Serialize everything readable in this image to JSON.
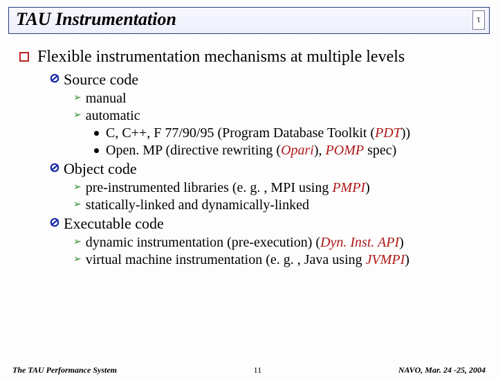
{
  "title": "TAU Instrumentation",
  "logo_glyph": "τ",
  "heading": "Flexible instrumentation mechanisms at multiple levels",
  "sections": {
    "source": {
      "label": "Source code",
      "items": {
        "manual": "manual",
        "automatic": "automatic",
        "auto_sub": {
          "a": {
            "plain": "C, C++, F 77/90/95 (Program Database Toolkit (",
            "em": "PDT",
            "tail": "))"
          },
          "b": {
            "plain": "Open. MP (directive rewriting (",
            "em": "Opari",
            "mid": "), ",
            "em2": "POMP",
            "tail": " spec)"
          }
        }
      }
    },
    "object": {
      "label": "Object code",
      "items": {
        "a": {
          "plain": "pre-instrumented libraries (e. g. , MPI using ",
          "em": "PMPI",
          "tail": ")"
        },
        "b": "statically-linked and dynamically-linked"
      }
    },
    "exec": {
      "label": "Executable code",
      "items": {
        "a": {
          "plain": "dynamic instrumentation (pre-execution) (",
          "em": "Dyn. Inst. API",
          "tail": ")"
        },
        "b": {
          "plain": "virtual machine instrumentation (e. g. , Java using ",
          "em": "JVMPI",
          "tail": ")"
        }
      }
    }
  },
  "footer": {
    "left": "The TAU Performance System",
    "center": "11",
    "right": "NAVO, Mar. 24 -25, 2004"
  }
}
